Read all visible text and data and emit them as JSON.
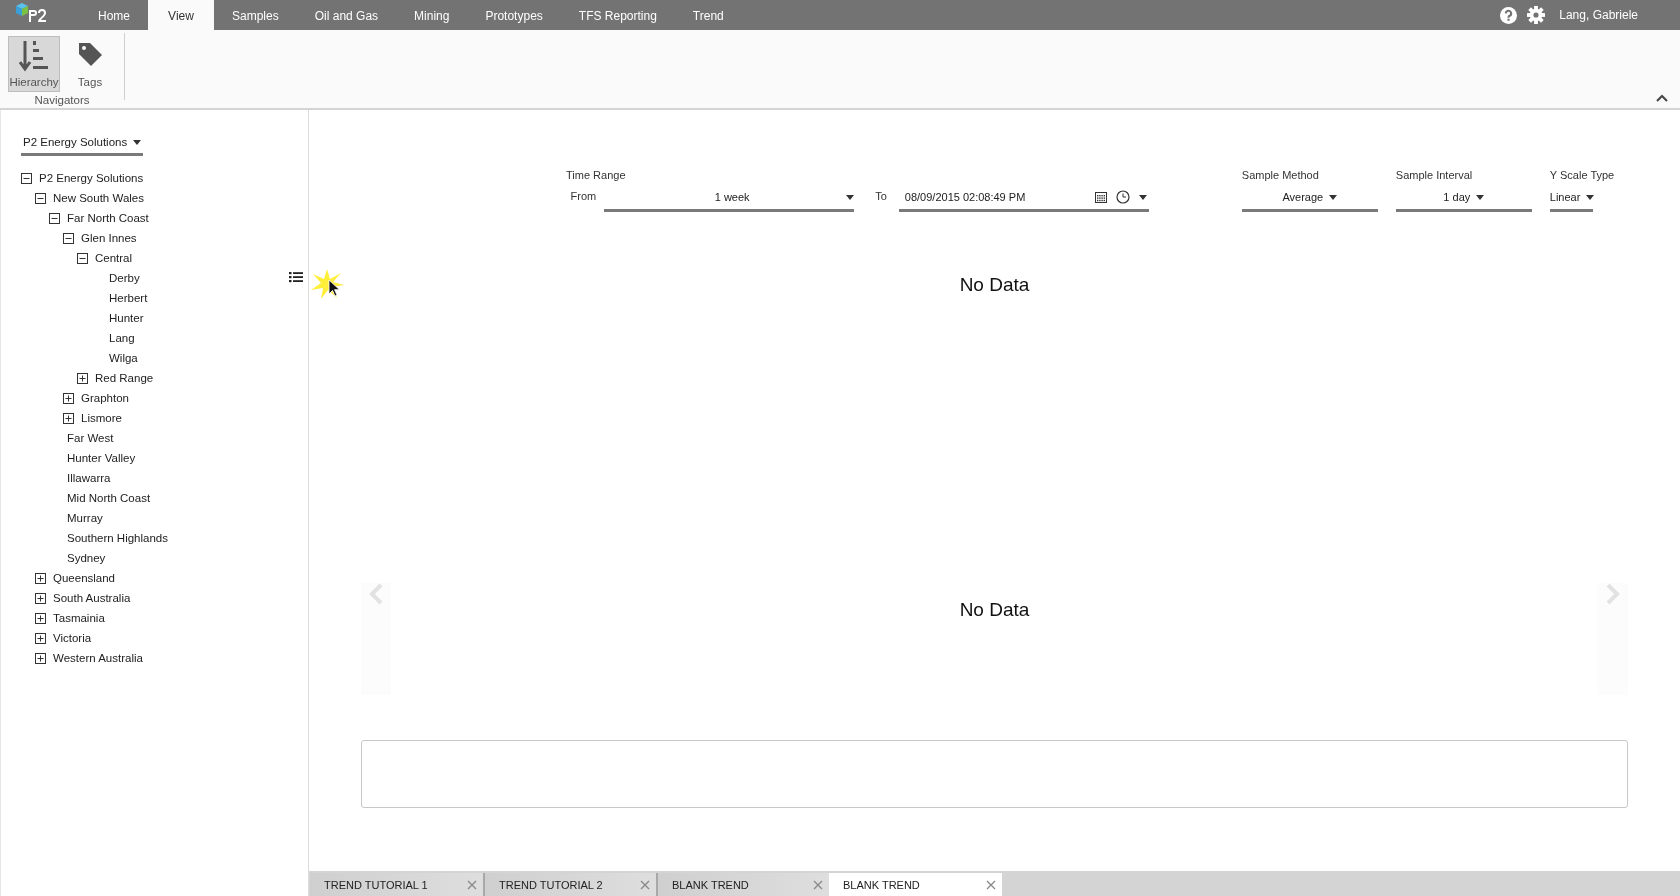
{
  "menu_tabs": [
    {
      "label": "Home",
      "selected": false
    },
    {
      "label": "View",
      "selected": true
    },
    {
      "label": "Samples",
      "selected": false
    },
    {
      "label": "Oil and Gas",
      "selected": false
    },
    {
      "label": "Mining",
      "selected": false
    },
    {
      "label": "Prototypes",
      "selected": false
    },
    {
      "label": "TFS Reporting",
      "selected": false
    },
    {
      "label": "Trend",
      "selected": false
    }
  ],
  "user": "Lang, Gabriele",
  "ribbon": {
    "group": "Navigators",
    "buttons": [
      {
        "label": "Hierarchy",
        "kind": "hierarchy",
        "selected": true
      },
      {
        "label": "Tags",
        "kind": "tags",
        "selected": false
      }
    ]
  },
  "hierarchy_selector": "P2 Energy Solutions",
  "tree": [
    {
      "label": "P2 Energy Solutions",
      "kind": "group",
      "expanded": true,
      "children": [
        {
          "label": "New South Wales",
          "kind": "group",
          "expanded": true,
          "children": [
            {
              "label": "Far North Coast",
              "kind": "group",
              "expanded": true,
              "children": [
                {
                  "label": "Glen Innes",
                  "kind": "group",
                  "expanded": true,
                  "children": [
                    {
                      "label": "Central",
                      "kind": "group",
                      "expanded": true,
                      "children": [
                        {
                          "label": "Derby",
                          "kind": "leaf",
                          "hovered": true
                        },
                        {
                          "label": "Herbert",
                          "kind": "leaf",
                          "hovered": false
                        },
                        {
                          "label": "Hunter",
                          "kind": "leaf",
                          "hovered": false
                        },
                        {
                          "label": "Lang",
                          "kind": "leaf",
                          "hovered": false
                        },
                        {
                          "label": "Wilga",
                          "kind": "leaf",
                          "hovered": false
                        }
                      ]
                    },
                    {
                      "label": "Red Range",
                      "kind": "group",
                      "expanded": false
                    }
                  ]
                },
                {
                  "label": "Graphton",
                  "kind": "group",
                  "expanded": false
                },
                {
                  "label": "Lismore",
                  "kind": "group",
                  "expanded": false
                }
              ]
            },
            {
              "label": "Far West",
              "kind": "leaf",
              "hovered": false
            },
            {
              "label": "Hunter Valley",
              "kind": "leaf",
              "hovered": false
            },
            {
              "label": "Illawarra",
              "kind": "leaf",
              "hovered": false
            },
            {
              "label": "Mid North Coast",
              "kind": "leaf",
              "hovered": false
            },
            {
              "label": "Murray",
              "kind": "leaf",
              "hovered": false
            },
            {
              "label": "Southern Highlands",
              "kind": "leaf",
              "hovered": false
            },
            {
              "label": "Sydney",
              "kind": "leaf",
              "hovered": false
            }
          ]
        },
        {
          "label": "Queensland",
          "kind": "group",
          "expanded": false
        },
        {
          "label": "South Australia",
          "kind": "group",
          "expanded": false
        },
        {
          "label": "Tasmainia",
          "kind": "group",
          "expanded": false
        },
        {
          "label": "Victoria",
          "kind": "group",
          "expanded": false
        },
        {
          "label": "Western Australia",
          "kind": "group",
          "expanded": false
        }
      ]
    }
  ],
  "controls": {
    "time_range_label": "Time Range",
    "from_label": "From",
    "from_value": "1 week",
    "to_label": "To",
    "to_value": "08/09/2015 02:08:49 PM",
    "sample_method_label": "Sample Method",
    "sample_method": "Average",
    "sample_interval_label": "Sample Interval",
    "sample_interval": "1 day",
    "y_scale_label": "Y Scale Type",
    "y_scale": "Linear"
  },
  "charts": [
    {
      "message": "No Data"
    },
    {
      "message": "No Data"
    }
  ],
  "document_tabs": [
    {
      "label": "TREND TUTORIAL 1",
      "selected": false
    },
    {
      "label": "TREND TUTORIAL 2",
      "selected": false
    },
    {
      "label": "BLANK TREND",
      "selected": false
    },
    {
      "label": "BLANK TREND",
      "selected": true
    }
  ]
}
